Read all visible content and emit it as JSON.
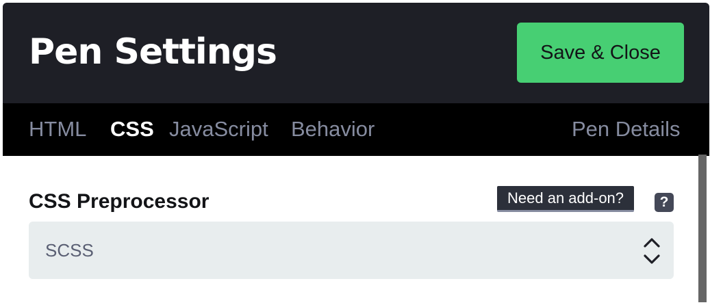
{
  "header": {
    "title": "Pen Settings",
    "save_label": "Save & Close"
  },
  "tabs": [
    {
      "label": "HTML",
      "active": false
    },
    {
      "label": "CSS",
      "active": true
    },
    {
      "label": "JavaScript",
      "active": false
    },
    {
      "label": "Behavior",
      "active": false
    },
    {
      "label": "Pen Details",
      "active": false
    }
  ],
  "css_section": {
    "label": "CSS Preprocessor",
    "addon_label": "Need an add-on?",
    "help_glyph": "?",
    "preprocessor_value": "SCSS"
  },
  "icons": {
    "help": "question-mark-icon",
    "select": "chevron-up-down-icon"
  },
  "colors": {
    "header_bg": "#1e1f26",
    "tabs_bg": "#000000",
    "save_button": "#47cf73",
    "select_bg": "#e8edee",
    "tab_inactive": "#868ca0"
  }
}
